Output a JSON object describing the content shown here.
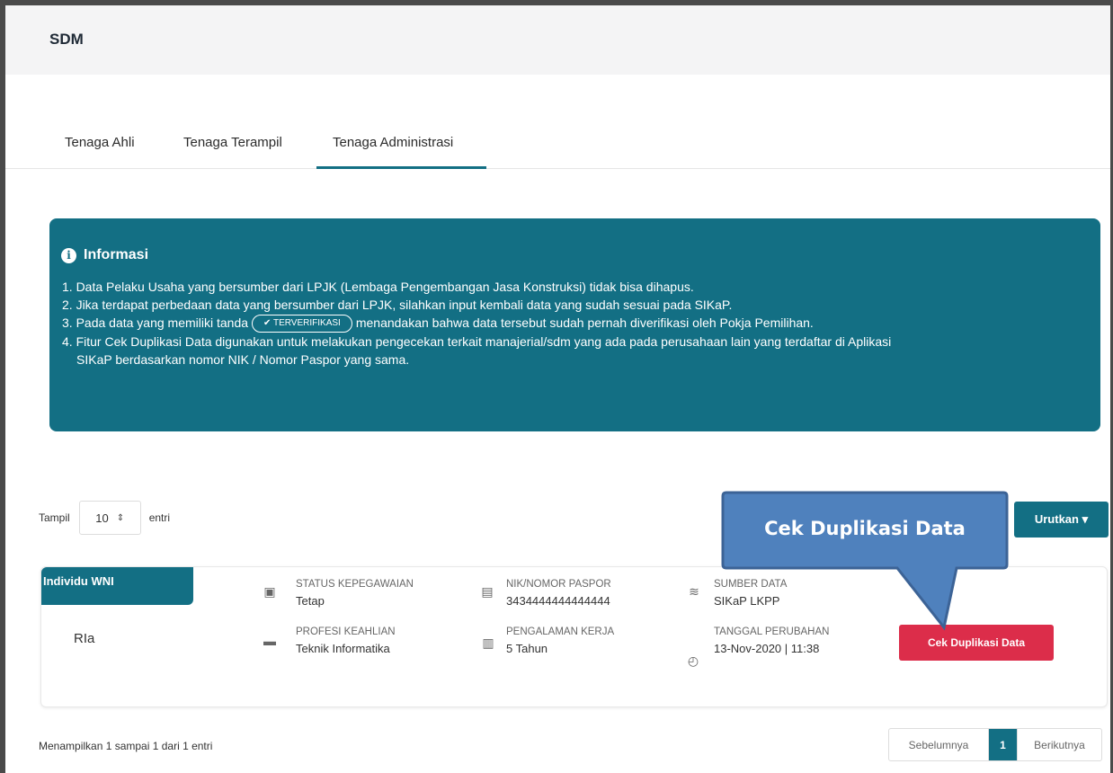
{
  "header": {
    "title": "SDM"
  },
  "tabs": [
    {
      "label": "Tenaga Ahli"
    },
    {
      "label": "Tenaga Terampil"
    },
    {
      "label": "Tenaga Administrasi",
      "active": true
    }
  ],
  "info": {
    "title": "Informasi",
    "line1": "1. Data Pelaku Usaha yang bersumber dari LPJK (Lembaga Pengembangan Jasa Konstruksi) tidak bisa dihapus.",
    "line2": "2. Jika terdapat perbedaan data yang bersumber dari LPJK, silahkan input kembali data yang sudah sesuai pada SIKaP.",
    "line3_pre": "3. Pada data yang memiliki tanda",
    "badge": "✔ TERVERIFIKASI",
    "line3_post": "menandakan bahwa data tersebut sudah pernah diverifikasi oleh Pokja Pemilihan.",
    "line4a": "4. Fitur Cek Duplikasi Data digunakan untuk melakukan pengecekan terkait manajerial/sdm yang ada pada perusahaan lain yang terdaftar di Aplikasi",
    "line4b": "SIKaP berdasarkan nomor NIK / Nomor Paspor yang sama."
  },
  "list_controls": {
    "show_label": "Tampil",
    "show_value": "10",
    "entries_label": "entri",
    "sort_label": "Urutkan ▾"
  },
  "card": {
    "tag": "Individu WNI",
    "name": "RIa",
    "status_label": "STATUS KEPEGAWAIAN",
    "status_value": "Tetap",
    "profesi_label": "PROFESI KEAHLIAN",
    "profesi_value": "Teknik Informatika",
    "nik_label": "NIK/NOMOR PASPOR",
    "nik_value": "3434444444444444",
    "pengalaman_label": "PENGALAMAN KERJA",
    "pengalaman_value": "5 Tahun",
    "sumber_label": "SUMBER DATA",
    "sumber_value": "SIKaP LKPP",
    "tanggal_label": "TANGGAL PERUBAHAN",
    "tanggal_value": "13-Nov-2020 | 11:38",
    "dup_button": "Cek Duplikasi Data"
  },
  "footer": {
    "summary": "Menampilkan 1 sampai 1 dari 1 entri",
    "prev": "Sebelumnya",
    "current": "1",
    "next": "Berikutnya"
  },
  "callout": {
    "text": "Cek Duplikasi Data"
  },
  "colors": {
    "primary": "#136f84",
    "danger": "#dc2d4a",
    "callout": "#4f81bd"
  }
}
